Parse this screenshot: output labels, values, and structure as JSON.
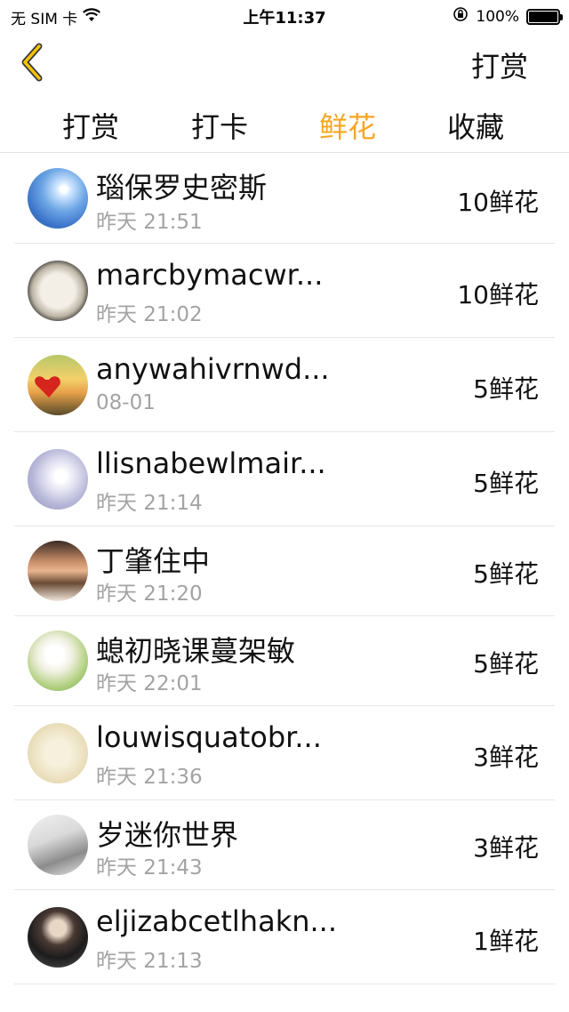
{
  "status_bar": {
    "carrier": "无 SIM 卡",
    "time": "上午11:37",
    "battery": "100%"
  },
  "nav": {
    "right_label": "打赏"
  },
  "tabs": [
    {
      "label": "打赏",
      "active": false
    },
    {
      "label": "打卡",
      "active": false
    },
    {
      "label": "鲜花",
      "active": true
    },
    {
      "label": "收藏",
      "active": false
    }
  ],
  "colors": {
    "accent": "#f5a623",
    "secondary_text": "#a3a3a3"
  },
  "rows": [
    {
      "name": "瑙保罗史密斯",
      "time": "昨天 21:51",
      "amount": "10鲜花"
    },
    {
      "name": "marcbymacwr...",
      "time": "昨天 21:02",
      "amount": "10鲜花"
    },
    {
      "name": "anywahivrnwd...",
      "time": "08-01",
      "amount": "5鲜花"
    },
    {
      "name": "llisnabewlmair...",
      "time": "昨天 21:14",
      "amount": "5鲜花"
    },
    {
      "name": "丁肇住中",
      "time": "昨天 21:20",
      "amount": "5鲜花"
    },
    {
      "name": "螅初晓课蔓架敏",
      "time": "昨天 22:01",
      "amount": "5鲜花"
    },
    {
      "name": "louwisquatobr...",
      "time": "昨天 21:36",
      "amount": "3鲜花"
    },
    {
      "name": "岁迷你世界",
      "time": "昨天 21:43",
      "amount": "3鲜花"
    },
    {
      "name": "eljizabcetlhakn...",
      "time": "昨天 21:13",
      "amount": "1鲜花"
    }
  ]
}
